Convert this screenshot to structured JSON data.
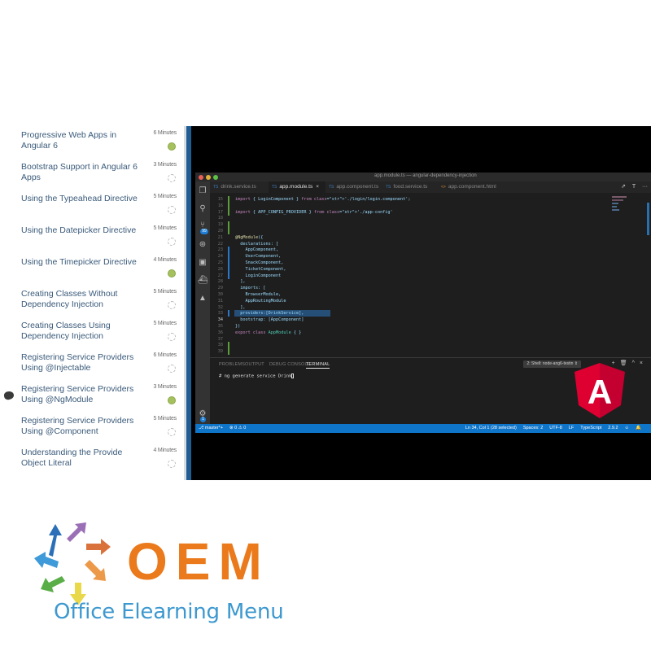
{
  "lessons": [
    {
      "title": "Progressive Web Apps in Angular 6",
      "duration": "6 Minutes",
      "status": "completed"
    },
    {
      "title": "Bootstrap Support in Angular 6 Apps",
      "duration": "3 Minutes",
      "status": "not-started"
    },
    {
      "title": "Using the Typeahead Directive",
      "duration": "5 Minutes",
      "status": "not-started"
    },
    {
      "title": "Using the Datepicker Directive",
      "duration": "5 Minutes",
      "status": "not-started"
    },
    {
      "title": "Using the Timepicker Directive",
      "duration": "4 Minutes",
      "status": "completed"
    },
    {
      "title": "Creating Classes Without Dependency Injection",
      "duration": "5 Minutes",
      "status": "not-started"
    },
    {
      "title": "Creating Classes Using Dependency Injection",
      "duration": "5 Minutes",
      "status": "not-started"
    },
    {
      "title": "Registering Service Providers Using @Injectable",
      "duration": "6 Minutes",
      "status": "not-started"
    },
    {
      "title": "Registering Service Providers Using @NgModule",
      "duration": "3 Minutes",
      "status": "completed",
      "current": true
    },
    {
      "title": "Registering Service Providers Using @Component",
      "duration": "5 Minutes",
      "status": "not-started"
    },
    {
      "title": "Understanding the Provide Object Literal",
      "duration": "4 Minutes",
      "status": "not-started"
    }
  ],
  "editor": {
    "window_title": "app.module.ts — angular-dependency-injection",
    "tabs": [
      {
        "label": "drink.service.ts",
        "type": "ts",
        "active": false
      },
      {
        "label": "app.module.ts",
        "type": "ts",
        "active": true
      },
      {
        "label": "app.component.ts",
        "type": "ts",
        "active": false
      },
      {
        "label": "food.service.ts",
        "type": "ts",
        "active": false
      },
      {
        "label": "app.component.html",
        "type": "html",
        "active": false
      }
    ],
    "activity_badge": "99",
    "settings_badge": "1",
    "code_lines": [
      {
        "n": "15",
        "text": "import { LoginComponent } from './login/login.component';"
      },
      {
        "n": "16",
        "text": ""
      },
      {
        "n": "17",
        "text": "import { APP_CONFIG_PROVIDER } from './app-config'"
      },
      {
        "n": "18",
        "text": ""
      },
      {
        "n": "19",
        "text": ""
      },
      {
        "n": "20",
        "text": ""
      },
      {
        "n": "21",
        "text": "@NgModule({"
      },
      {
        "n": "22",
        "text": "  declarations: ["
      },
      {
        "n": "23",
        "text": "    AppComponent,"
      },
      {
        "n": "24",
        "text": "    UserComponent,"
      },
      {
        "n": "25",
        "text": "    SnackComponent,"
      },
      {
        "n": "26",
        "text": "    TicketComponent,"
      },
      {
        "n": "27",
        "text": "    LoginComponent"
      },
      {
        "n": "28",
        "text": "  ],"
      },
      {
        "n": "29",
        "text": "  imports: ["
      },
      {
        "n": "30",
        "text": "    BrowserModule,"
      },
      {
        "n": "31",
        "text": "    AppRoutingModule"
      },
      {
        "n": "32",
        "text": "  ],"
      },
      {
        "n": "33",
        "text": "  providers:[DrinkService],"
      },
      {
        "n": "34",
        "text": "  bootstrap: [AppComponent]"
      },
      {
        "n": "35",
        "text": "})"
      },
      {
        "n": "36",
        "text": "export class AppModule { }"
      },
      {
        "n": "37",
        "text": ""
      },
      {
        "n": "38",
        "text": ""
      },
      {
        "n": "39",
        "text": ""
      }
    ],
    "panel_tabs": [
      "PROBLEMS",
      "OUTPUT",
      "DEBUG CONSOLE",
      "TERMINAL"
    ],
    "active_panel_tab": "TERMINAL",
    "shell_select": "2: Shell: node-ang6-testin ⇕",
    "terminal_prompt": "# ng generate service Drink",
    "status_left": [
      "⎇ master*+",
      "⊗ 0 ⚠ 0"
    ],
    "status_right": [
      "Ln 34, Col 1 (28 selected)",
      "Spaces: 2",
      "UTF-8",
      "LF",
      "TypeScript",
      "2.9.2",
      "☺",
      "🔔"
    ]
  },
  "overlay_logo": "A",
  "brand": {
    "mark": "OEM",
    "name": "Office Elearning Menu",
    "colors": {
      "mark": "#ea7a1b",
      "name": "#3d98cf"
    }
  },
  "status_colors": {
    "completed": "#a4c15e",
    "pending_border": "#b8b8b8"
  }
}
